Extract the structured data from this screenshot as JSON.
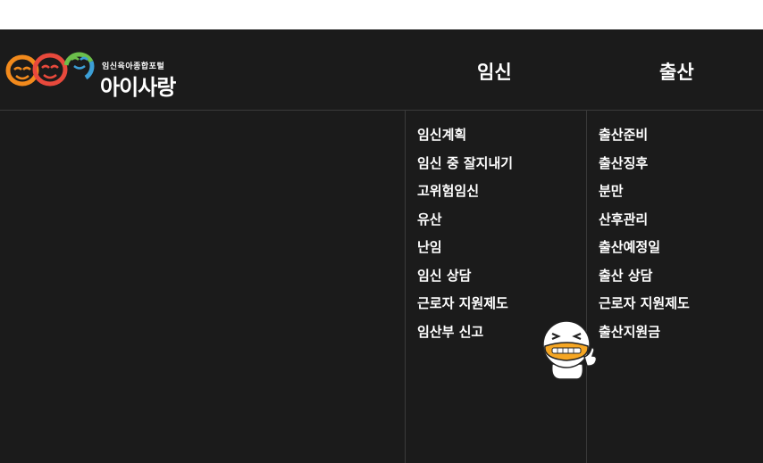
{
  "logo": {
    "tagline": "임신육아종합포털",
    "name": "아이사랑"
  },
  "menus": [
    {
      "title": "임신",
      "items": [
        "임신계획",
        "임신 중 잘지내기",
        "고위험임신",
        "유산",
        "난임",
        "임신 상담",
        "근로자 지원제도",
        "임산부 신고"
      ]
    },
    {
      "title": "출산",
      "items": [
        "출산준비",
        "출산징후",
        "분만",
        "산후관리",
        "출산예정일",
        "출산 상담",
        "근로자 지원제도",
        "출산지원금"
      ]
    }
  ],
  "colors": {
    "background": "#1b1b1b",
    "divider": "#3a3a3a",
    "text": "#ffffff",
    "logo_orange": "#f28a1c",
    "logo_red": "#e8493c",
    "logo_green": "#6cbf4b",
    "logo_blue": "#3c9fd6"
  }
}
